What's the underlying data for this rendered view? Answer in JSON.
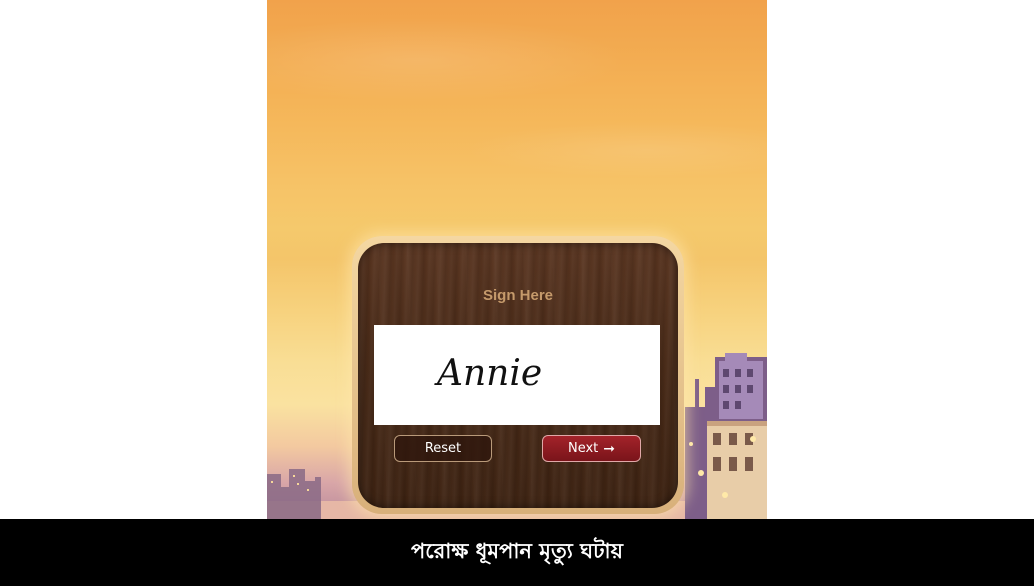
{
  "signature_panel": {
    "title": "Sign Here",
    "signature_text": "Annie",
    "reset_label": "Reset",
    "next_label": "Next",
    "next_icon": "arrow-right-icon",
    "next_button_color": "#8c1b22"
  },
  "footer": {
    "warning": "পরোক্ষ ধূমপান মৃত্যু ঘটায়"
  }
}
